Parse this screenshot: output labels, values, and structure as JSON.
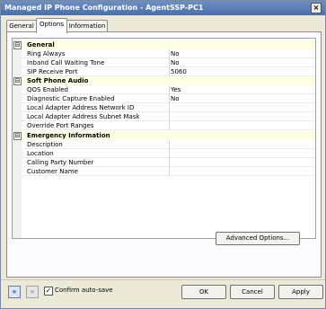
{
  "window": {
    "title": "Managed IP Phone Configuration - AgentSSP-PC1",
    "close_glyph": "×"
  },
  "tabs": [
    {
      "label": "General"
    },
    {
      "label": "Options"
    },
    {
      "label": "Information"
    }
  ],
  "grid": {
    "categories": [
      {
        "label": "General",
        "toggle": "⊟",
        "props": [
          {
            "label": "Ring Always",
            "value": "No"
          },
          {
            "label": "Inband Call Waiting Tone",
            "value": "No"
          },
          {
            "label": "SIP Receive Port",
            "value": "5060"
          }
        ]
      },
      {
        "label": "Soft Phone Audio",
        "toggle": "⊟",
        "props": [
          {
            "label": "QOS Enabled",
            "value": "Yes"
          },
          {
            "label": "Diagnostic Capture Enabled",
            "value": "No"
          },
          {
            "label": "Local Adapter Address Network ID",
            "value": ""
          },
          {
            "label": "Local Adapter Address Subnet Mask",
            "value": ""
          },
          {
            "label": "Override Port Ranges",
            "value": ""
          }
        ]
      },
      {
        "label": "Emergency Information",
        "toggle": "⊟",
        "props": [
          {
            "label": "Description",
            "value": ""
          },
          {
            "label": "Location",
            "value": ""
          },
          {
            "label": "Calling Party Number",
            "value": ""
          },
          {
            "label": "Customer Name",
            "value": ""
          }
        ]
      }
    ]
  },
  "buttons": {
    "advanced": "Advanced Options...",
    "ok": "OK",
    "cancel": "Cancel",
    "apply": "Apply"
  },
  "footer": {
    "back_glyph": "«",
    "forward_glyph": "»",
    "confirm_label": "Confirm auto-save",
    "confirm_checked": true,
    "check_glyph": "✓"
  }
}
